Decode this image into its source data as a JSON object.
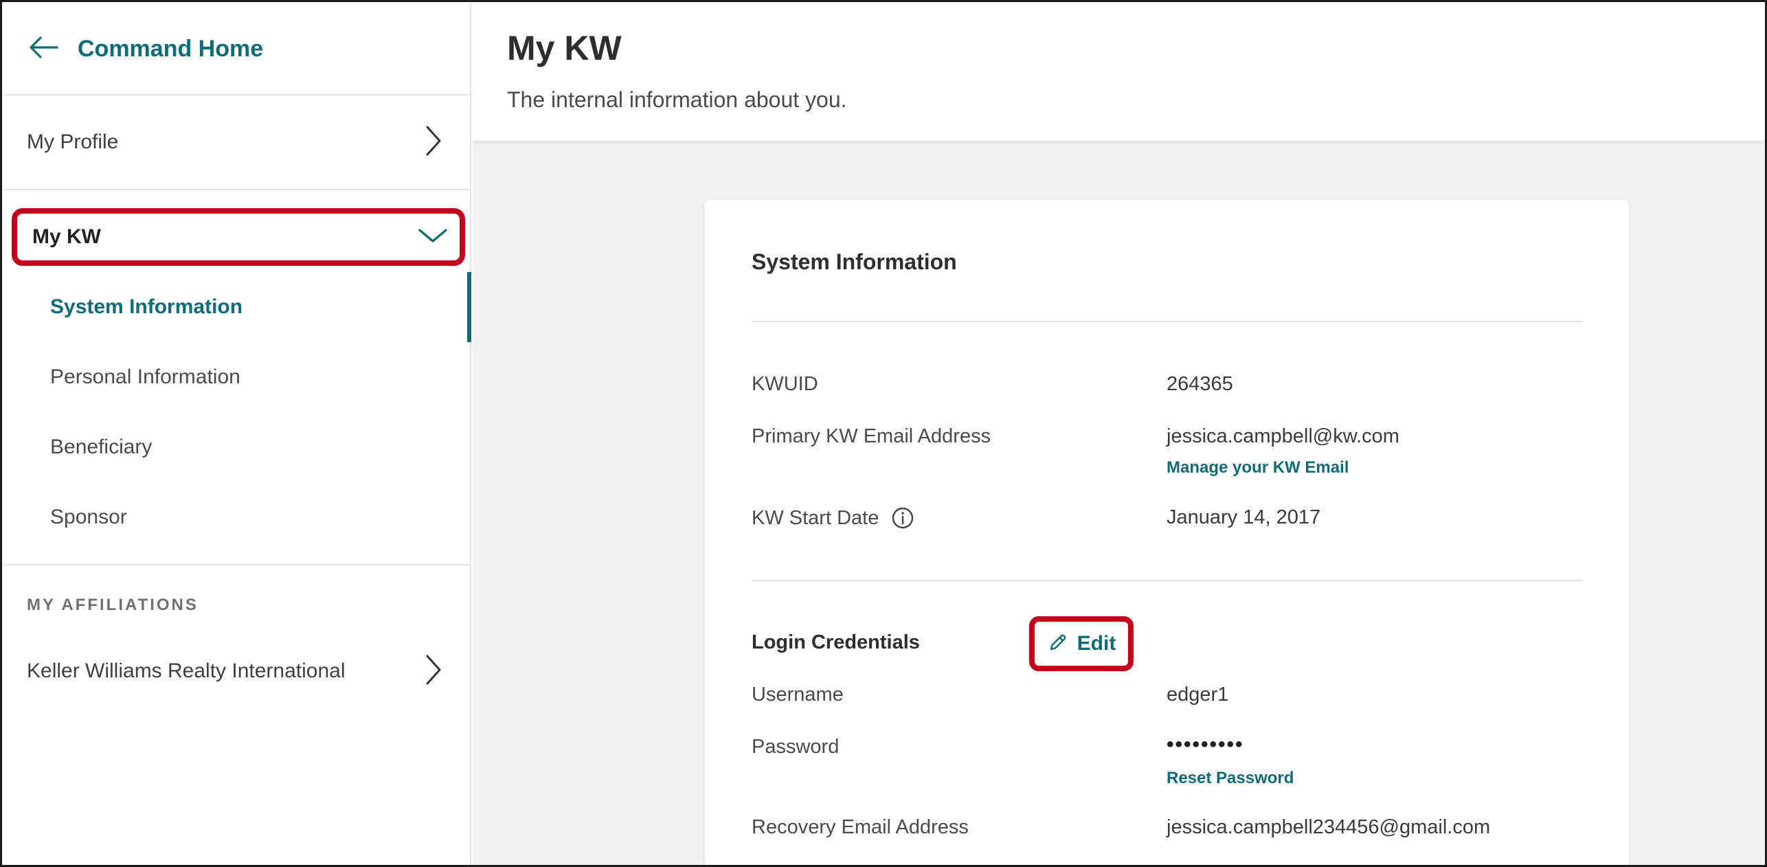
{
  "sidebar": {
    "back_link": "Command Home",
    "items": [
      {
        "label": "My Profile"
      },
      {
        "label": "My KW"
      }
    ],
    "sub_items": [
      {
        "label": "System Information",
        "active": true
      },
      {
        "label": "Personal Information"
      },
      {
        "label": "Beneficiary"
      },
      {
        "label": "Sponsor"
      }
    ],
    "affiliations_heading": "MY AFFILIATIONS",
    "affiliations": [
      {
        "label": "Keller Williams Realty International"
      }
    ]
  },
  "header": {
    "title": "My KW",
    "subtitle": "The internal information about you."
  },
  "card": {
    "title": "System Information",
    "fields": {
      "kwuid_label": "KWUID",
      "kwuid_value": "264365",
      "email_label": "Primary KW Email Address",
      "email_value": "jessica.campbell@kw.com",
      "email_link": "Manage your KW Email",
      "start_label": "KW Start Date",
      "start_value": "January 14, 2017"
    },
    "login": {
      "title": "Login Credentials",
      "edit_label": "Edit",
      "username_label": "Username",
      "username_value": "edger1",
      "password_label": "Password",
      "password_value": "•••••••••",
      "reset_link": "Reset Password",
      "recovery_label": "Recovery Email Address",
      "recovery_value": "jessica.campbell234456@gmail.com"
    }
  },
  "colors": {
    "accent": "#0e6b7a",
    "highlight": "#c4021b"
  },
  "icons": [
    "arrow-left-icon",
    "chevron-right-icon",
    "chevron-down-icon",
    "info-icon",
    "pencil-icon"
  ]
}
